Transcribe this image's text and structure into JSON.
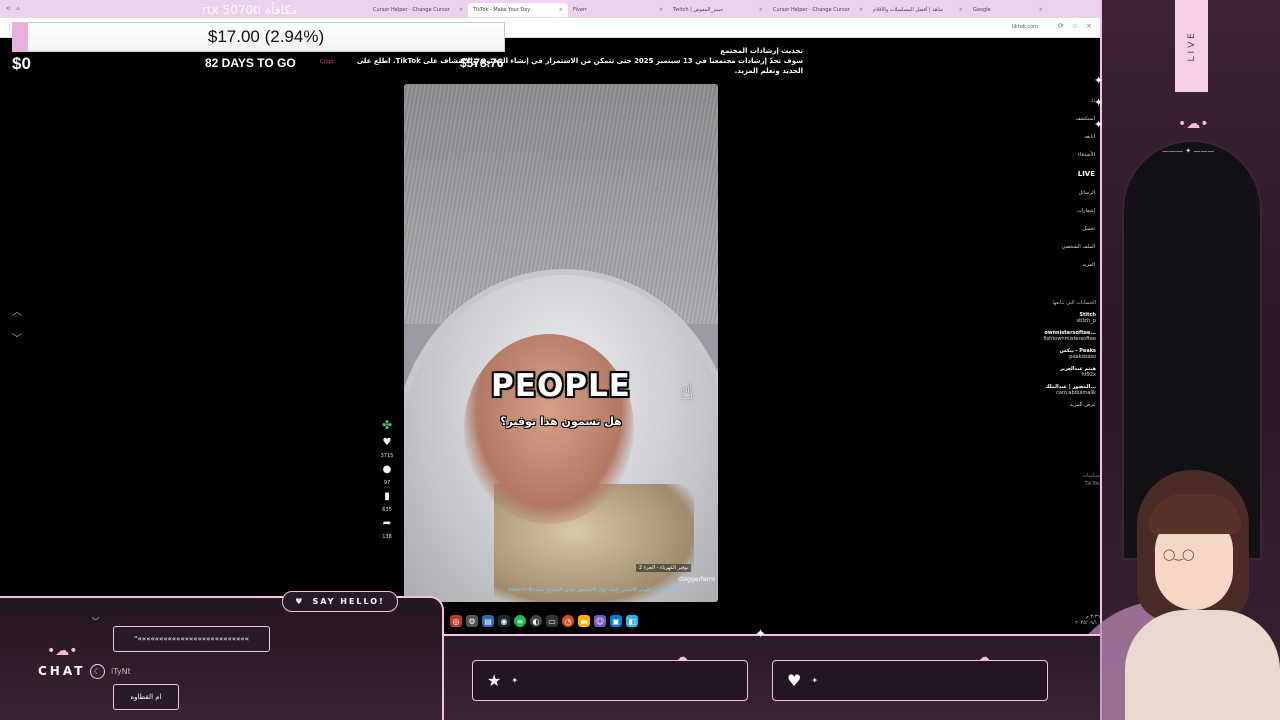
{
  "browser": {
    "tabs": [
      {
        "label": "Cursor Helper - Change Cursor",
        "active": false
      },
      {
        "label": "TikTok - Make Your Day",
        "active": true
      },
      {
        "label": "Fiverr",
        "active": false
      },
      {
        "label": "Twitch | جيمز_المفوض",
        "active": false
      },
      {
        "label": "Cursor Helper - Change Cursor",
        "active": false
      },
      {
        "label": "شاهد | أفضل المسلسلات والأفلام",
        "active": false
      },
      {
        "label": "Google",
        "active": false
      }
    ],
    "ghost_tab_text": "rtx 5070ti مكافأة",
    "url": "tiktok.com"
  },
  "stream_overlay": {
    "ticker": "$17.00 (2.94%)",
    "balance": "$0",
    "days_to_go": "82 DAYS TO GO",
    "goal": "$578.76",
    "tiny_label": "Crypt",
    "live_label": "LIVE",
    "say_hello": "SAY HELLO!",
    "chat_label": "CHAT",
    "chat_user": "iTyNt",
    "chat_bubble_1": "“««««««««««««««««««««««««««",
    "chat_bubble_2": "ام القطاوه"
  },
  "notice": {
    "title": "تحديث إرشادات المجتمع",
    "body": "سوف تحدّ إرشادات مجتمعنا في 13 سبتمبر 2025 حتى تتمكن من الاستمرار في إنشاء المحتوى والاكتشاف على TikTok. اطلع على الجديد وتعلم المزيد."
  },
  "video": {
    "caption": "PEOPLE",
    "subtitle": "هل تسمون هذا توفير؟",
    "tag": "توفير الكهرباء - الجزء 2",
    "author": "stoggerferro",
    "hashtags": "paperrr #توفير_فلوس #تحدي_التيك_توك #تخفيض_عادي #نصائح_مفيدة CapCut",
    "likes": "3715",
    "comments": "97",
    "saves": "635",
    "shares": "138"
  },
  "sidenav": {
    "items": [
      "لك",
      "استكشف",
      "أتابعه",
      "الأصدقاء",
      "LIVE",
      "الرسائل",
      "إشعارات",
      "تحميل",
      "الملف الشخصي",
      "المزيد"
    ],
    "following_header": "الحسابات التي تتابعها",
    "following": [
      {
        "name": "Stitch",
        "handle": "stitch_p"
      },
      {
        "name": "ownnistersoftee...",
        "handle": "fishtownmistersoftee"
      },
      {
        "name": "بيكس - Peaks",
        "handle": "peaksbaso"
      },
      {
        "name": "هيثم عبدالعزيز",
        "handle": "ht92x"
      },
      {
        "name": "المصور | عبدالملك...",
        "handle": "cam.abdulmalik"
      }
    ],
    "see_more": "عرض المزيد",
    "footer": [
      "سياسات",
      "TikTok"
    ]
  },
  "taskbar": {
    "time": "٣:٣٦ م",
    "date": "٢٠٢٥/٠٩/١٠"
  }
}
